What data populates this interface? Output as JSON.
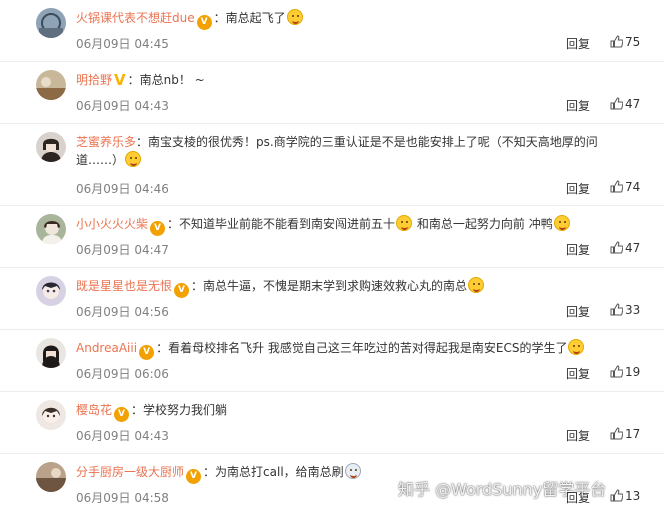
{
  "reply_label": "回复",
  "comments": [
    {
      "name": "火锅课代表不想赶due",
      "text": "南总起飞了",
      "time": "06月09日 04:45",
      "likes": "75"
    },
    {
      "name": "明拾野",
      "text": "南总nb！ ~",
      "time": "06月09日 04:43",
      "likes": "47"
    },
    {
      "name": "芝蜜养乐多",
      "text": "南宝支棱的很优秀！ps.商学院的三重认证是不是也能安排上了呢（不知天高地厚的问",
      "text2": "道……）",
      "time": "06月09日 04:46",
      "likes": "74"
    },
    {
      "name": "小小火火火柴",
      "text": "不知道毕业前能不能看到南安闯进前五十",
      "text_b": "和南总一起努力向前 冲鸭",
      "time": "06月09日 04:47",
      "likes": "47"
    },
    {
      "name": "既是星星也是无恨",
      "text": "南总牛逼，不愧是期末学到求购速效救心丸的南总",
      "time": "06月09日 04:56",
      "likes": "33"
    },
    {
      "name": "AndreaAiii",
      "text": "看着母校排名飞升 我感觉自己这三年吃过的苦对得起我是南安ECS的学生了",
      "time": "06月09日 06:06",
      "likes": "19"
    },
    {
      "name": "樱岛花",
      "text": "学校努力我们躺",
      "time": "06月09日 04:43",
      "likes": "17"
    },
    {
      "name": "分手厨房一级大厨师",
      "text": "为南总打call，给南总刷",
      "time": "06月09日 04:58",
      "likes": "13"
    }
  ],
  "watermark": "知乎 @WordSunny留学平台",
  "colors": {
    "name": "#eb7350",
    "meta": "#808080",
    "divider": "#ececec"
  }
}
